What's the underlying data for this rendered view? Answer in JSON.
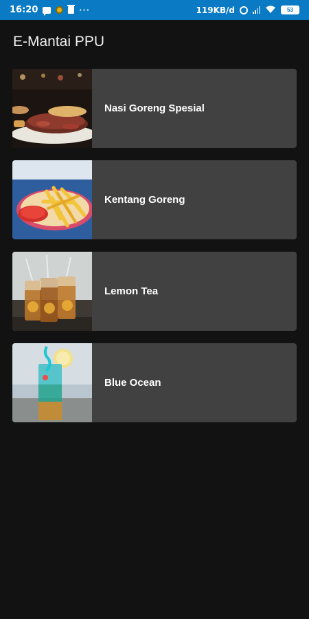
{
  "status_bar": {
    "time": "16:20",
    "speed": "119KB/d",
    "battery": "53",
    "icons": [
      "message-icon",
      "coin-icon",
      "trash-icon",
      "more-dots-icon",
      "alarm-icon",
      "signal-icon",
      "wifi-icon",
      "battery-icon"
    ],
    "color": "#0a7ac4"
  },
  "app": {
    "title": "E-Mantai PPU"
  },
  "menu": {
    "items": [
      {
        "name": "Nasi Goreng Spesial",
        "image": "nasi-goreng-photo"
      },
      {
        "name": "Kentang Goreng",
        "image": "french-fries-photo"
      },
      {
        "name": "Lemon Tea",
        "image": "lemon-tea-photo"
      },
      {
        "name": "Blue Ocean",
        "image": "blue-ocean-drink-photo"
      }
    ]
  },
  "colors": {
    "background": "#121212",
    "card": "#414141",
    "text": "#ffffff"
  }
}
